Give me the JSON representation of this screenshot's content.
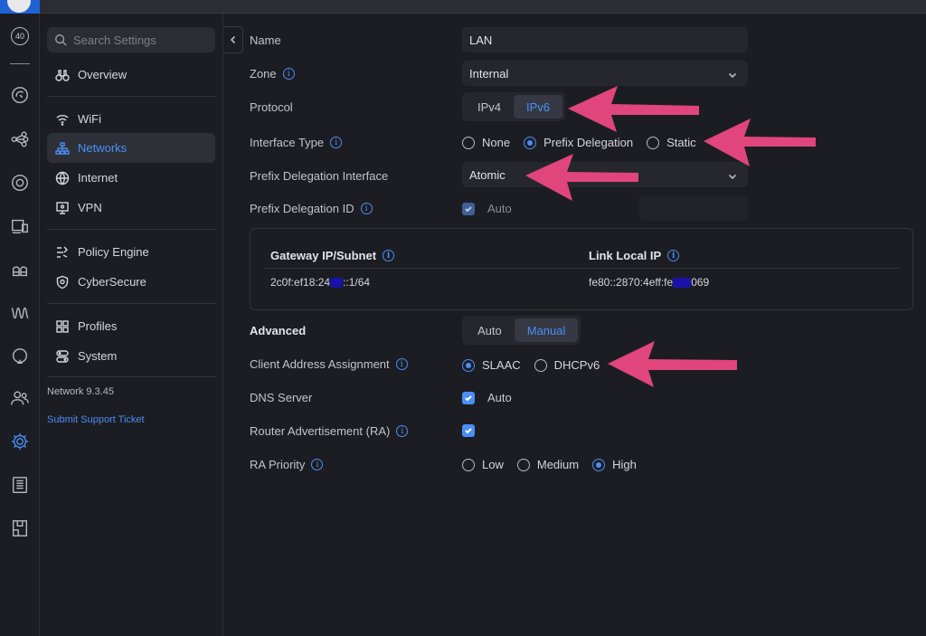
{
  "app": {
    "topbar_logo": "ui-logo",
    "accent": "#4b8ef7",
    "annotation_arrow_color": "#e0457b"
  },
  "rail": {
    "badge_text": "40",
    "icons": [
      "dashboard-badge-icon",
      "topology-icon",
      "clients-icon",
      "devices-icon",
      "ports-icon",
      "cameras-icon",
      "insights-icon",
      "radio-icon",
      "hotspot-icon",
      "admins-icon",
      "settings-icon",
      "logs-icon",
      "reports-icon"
    ]
  },
  "sidebar": {
    "search_placeholder": "Search Settings",
    "items": [
      {
        "label": "Overview",
        "icon": "binoculars-icon"
      },
      {
        "label": "WiFi",
        "icon": "wifi-icon"
      },
      {
        "label": "Networks",
        "icon": "network-icon"
      },
      {
        "label": "Internet",
        "icon": "globe-icon"
      },
      {
        "label": "VPN",
        "icon": "vpn-icon"
      },
      {
        "label": "Policy Engine",
        "icon": "policy-icon"
      },
      {
        "label": "CyberSecure",
        "icon": "shield-icon"
      },
      {
        "label": "Profiles",
        "icon": "profiles-icon"
      },
      {
        "label": "System",
        "icon": "system-icon"
      }
    ],
    "version": "Network 9.3.45",
    "support_link": "Submit Support Ticket"
  },
  "form": {
    "name_label": "Name",
    "name_value": "LAN",
    "zone_label": "Zone",
    "zone_value": "Internal",
    "protocol_label": "Protocol",
    "protocol_options": [
      "IPv4",
      "IPv6"
    ],
    "protocol_selected": "IPv6",
    "interface_type_label": "Interface Type",
    "interface_type_options": [
      "None",
      "Prefix Delegation",
      "Static"
    ],
    "interface_type_selected": "Prefix Delegation",
    "pd_interface_label": "Prefix Delegation Interface",
    "pd_interface_value": "Atomic",
    "pd_id_label": "Prefix Delegation ID",
    "pd_id_auto": "Auto",
    "gateway_header": "Gateway IP/Subnet",
    "gateway_value_a": "2c0f:ef18:24",
    "gateway_value_b": "::1/64",
    "link_local_header": "Link Local IP",
    "link_local_a": "fe80::2870:4eff:fe",
    "link_local_b": "069",
    "advanced_label": "Advanced",
    "advanced_options": [
      "Auto",
      "Manual"
    ],
    "advanced_selected": "Manual",
    "client_assign_label": "Client Address Assignment",
    "client_assign_options": [
      "SLAAC",
      "DHCPv6"
    ],
    "client_assign_selected": "SLAAC",
    "dns_label": "DNS Server",
    "dns_auto": "Auto",
    "ra_label": "Router Advertisement (RA)",
    "ra_priority_label": "RA Priority",
    "ra_priority_options": [
      "Low",
      "Medium",
      "High"
    ],
    "ra_priority_selected": "High"
  }
}
